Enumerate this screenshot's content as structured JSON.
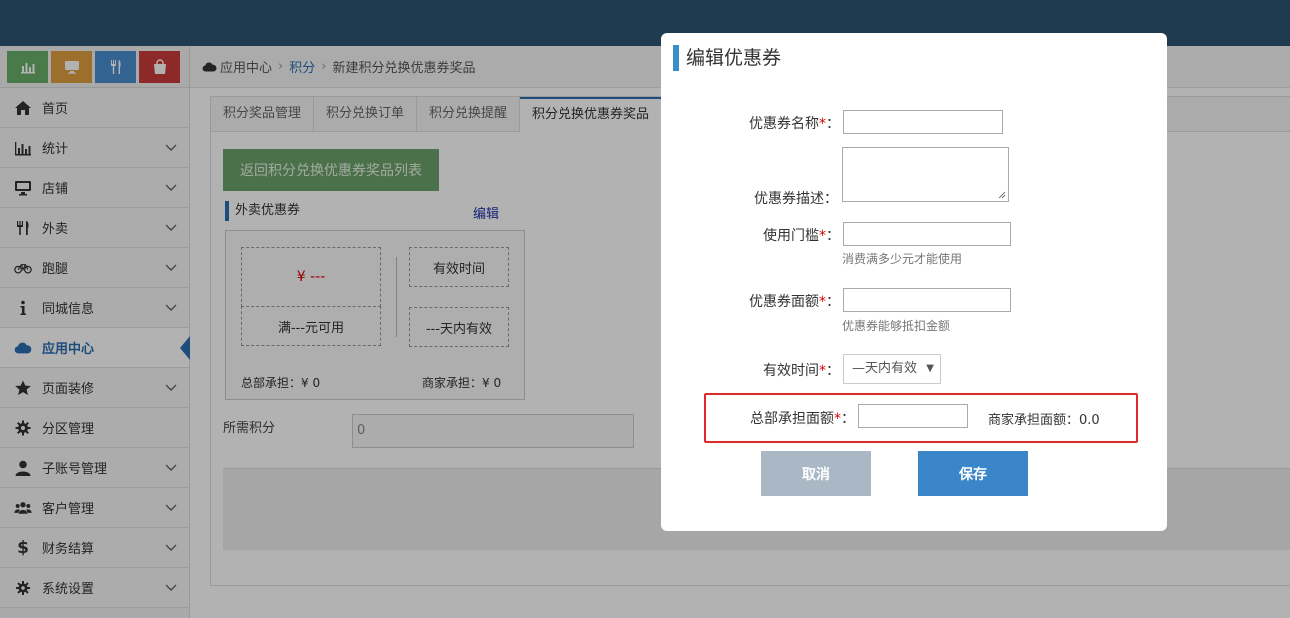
{
  "sidebar": {
    "shortcuts": [
      {
        "icon": "bar-chart-icon",
        "color": "#68b069"
      },
      {
        "icon": "monitor-icon",
        "color": "#e0a040"
      },
      {
        "icon": "utensils-icon",
        "color": "#4a8fcf"
      },
      {
        "icon": "shopping-bag-icon",
        "color": "#cc3b3b"
      }
    ],
    "items": [
      {
        "label": "首页",
        "icon": "home-icon",
        "chevron": false
      },
      {
        "label": "统计",
        "icon": "bar-chart-icon",
        "chevron": true
      },
      {
        "label": "店铺",
        "icon": "monitor-icon",
        "chevron": true
      },
      {
        "label": "外卖",
        "icon": "utensils-icon",
        "chevron": true
      },
      {
        "label": "跑腿",
        "icon": "bicycle-icon",
        "chevron": true
      },
      {
        "label": "同城信息",
        "icon": "info-icon",
        "chevron": true
      },
      {
        "label": "应用中心",
        "icon": "cloud-icon",
        "chevron": false,
        "active": true
      },
      {
        "label": "页面装修",
        "icon": "star-icon",
        "chevron": true
      },
      {
        "label": "分区管理",
        "icon": "gear-icon",
        "chevron": false
      },
      {
        "label": "子账号管理",
        "icon": "user-icon",
        "chevron": true
      },
      {
        "label": "客户管理",
        "icon": "users-icon",
        "chevron": true
      },
      {
        "label": "财务结算",
        "icon": "dollar-icon",
        "chevron": true
      },
      {
        "label": "系统设置",
        "icon": "settings-icon",
        "chevron": true
      }
    ]
  },
  "breadcrumb": {
    "root": "应用中心",
    "level1": "积分",
    "current": "新建积分兑换优惠券奖品"
  },
  "tabs": [
    "积分奖品管理",
    "积分兑换订单",
    "积分兑换提醒",
    "积分兑换优惠券奖品"
  ],
  "main": {
    "back_button": "返回积分兑换优惠券奖品列表",
    "coupon_section_title": "外卖优惠券",
    "edit_link": "编辑",
    "coupon": {
      "price": "¥ ---",
      "condition": "满---元可用",
      "validity_label": "有效时间",
      "validity_value": "---天内有效",
      "hq_share": "总部承担：¥ 0",
      "merchant_share": "商家承担：¥ 0"
    },
    "points_label": "所需积分",
    "points_value": "0"
  },
  "modal": {
    "title": "编辑优惠券",
    "name_label": "优惠券名称",
    "desc_label": "优惠券描述",
    "threshold_label": "使用门槛",
    "threshold_hint": "消费满多少元才能使用",
    "amount_label": "优惠券面额",
    "amount_hint": "优惠券能够抵扣金额",
    "validity_label": "有效时间",
    "validity_selected": "—天内有效",
    "hq_amount_label": "总部承担面额",
    "merchant_amount": "商家承担面额：0.0",
    "required_mark": "*",
    "colon": "：",
    "cancel_label": "取消",
    "save_label": "保存"
  }
}
